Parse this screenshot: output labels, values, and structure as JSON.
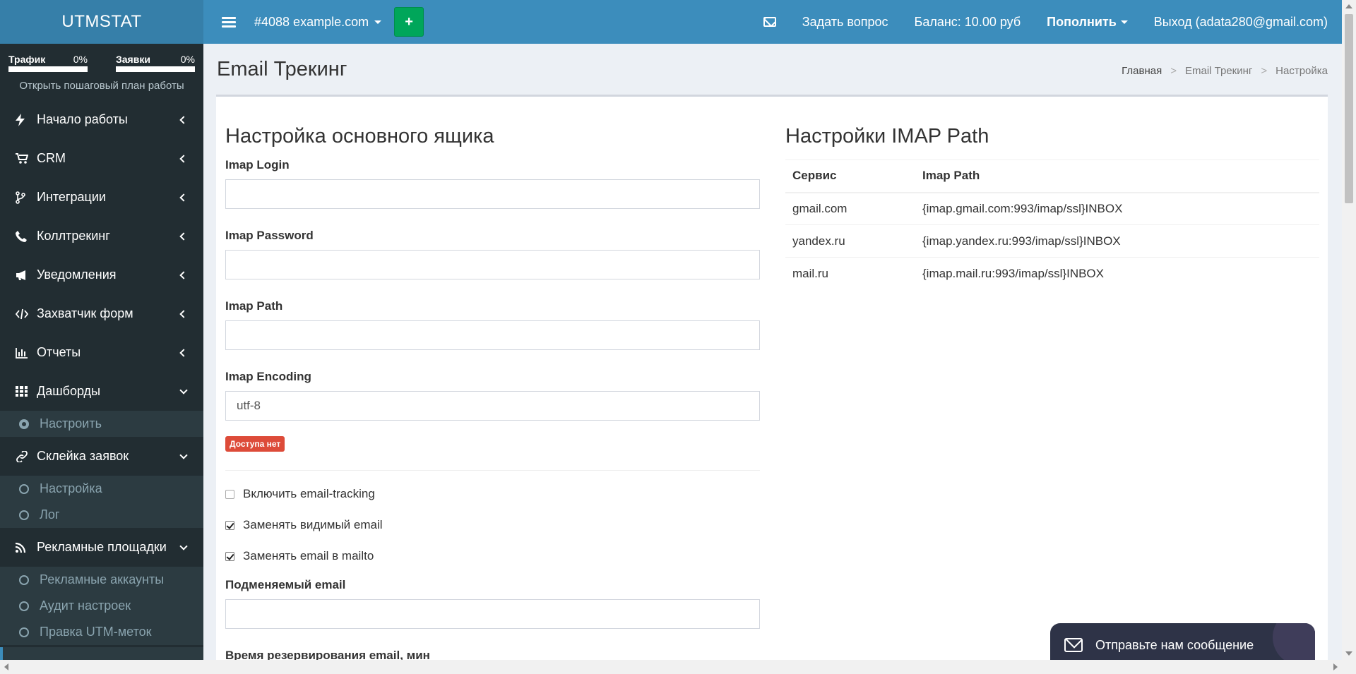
{
  "header": {
    "logo": "UTMSTAT",
    "project": "#4088 example.com",
    "add_label": "+",
    "ask_question": "Задать вопрос",
    "balance": "Баланс: 10.00 руб",
    "topup": "Пополнить",
    "logout": "Выход (adata280@gmail.com)"
  },
  "sidebar": {
    "traffic_label": "Трафик",
    "traffic_pct": "0%",
    "requests_label": "Заявки",
    "requests_pct": "0%",
    "plan_link": "Открыть пошаговый план работы",
    "items": [
      {
        "label": "Начало работы",
        "icon": "bolt-icon"
      },
      {
        "label": "CRM",
        "icon": "cart-icon"
      },
      {
        "label": "Интеграции",
        "icon": "branch-icon"
      },
      {
        "label": "Коллтрекинг",
        "icon": "phone-icon"
      },
      {
        "label": "Уведомления",
        "icon": "bullhorn-icon"
      },
      {
        "label": "Захватчик форм",
        "icon": "code-icon"
      },
      {
        "label": "Отчеты",
        "icon": "bar-chart-icon"
      },
      {
        "label": "Дашборды",
        "icon": "grid-icon"
      },
      {
        "label": "Склейка заявок",
        "icon": "link-icon"
      },
      {
        "label": "Рекламные площадки",
        "icon": "rss-icon"
      }
    ],
    "dashboards_sub": [
      "Настроить"
    ],
    "merge_sub": [
      "Настройка",
      "Лог"
    ],
    "ads_sub": [
      "Рекламные аккаунты",
      "Аудит настроек",
      "Правка UTM-меток"
    ]
  },
  "page": {
    "title": "Email Трекинг",
    "breadcrumb": [
      "Главная",
      "Email Трекинг",
      "Настройка"
    ]
  },
  "form": {
    "heading": "Настройка основного ящика",
    "login_label": "Imap Login",
    "login_value": "",
    "password_label": "Imap Password",
    "password_value": "",
    "path_label": "Imap Path",
    "path_value": "",
    "encoding_label": "Imap Encoding",
    "encoding_value": "utf-8",
    "status_badge": "Доступа нет",
    "enable_tracking": "Включить email-tracking",
    "replace_visible": "Заменять видимый email",
    "replace_mailto": "Заменять email в mailto",
    "replaced_email_label": "Подменяемый email",
    "replaced_email_value": "",
    "reserve_time_label": "Время резервирования email, мин"
  },
  "imap_table": {
    "heading": "Настройки IMAP Path",
    "columns": [
      "Сервис",
      "Imap Path"
    ],
    "rows": [
      [
        "gmail.com",
        "{imap.gmail.com:993/imap/ssl}INBOX"
      ],
      [
        "yandex.ru",
        "{imap.yandex.ru:993/imap/ssl}INBOX"
      ],
      [
        "mail.ru",
        "{imap.mail.ru:993/imap/ssl}INBOX"
      ]
    ]
  },
  "chat": {
    "label": "Отправьте нам сообщение"
  }
}
